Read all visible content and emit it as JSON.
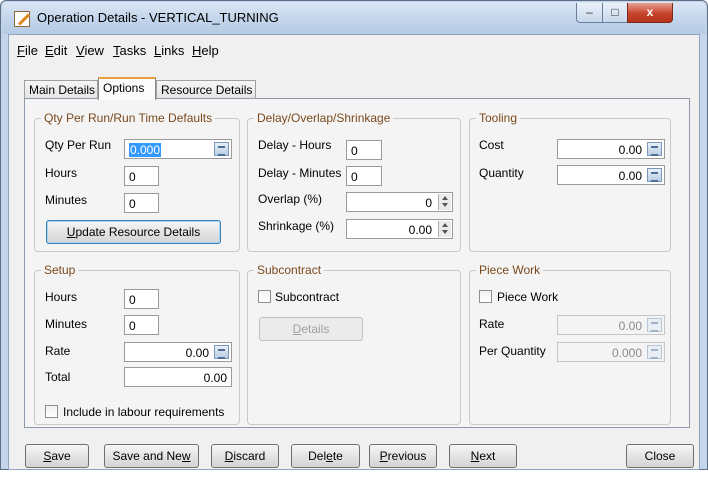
{
  "window": {
    "title": "Operation Details - VERTICAL_TURNING",
    "minimize_glyph": "–",
    "maximize_glyph": "□",
    "close_glyph": "x"
  },
  "menu": [
    {
      "label": "File",
      "access": "F",
      "rest": "ile"
    },
    {
      "label": "Edit",
      "access": "E",
      "rest": "dit"
    },
    {
      "label": "View",
      "access": "V",
      "rest": "iew"
    },
    {
      "label": "Tasks",
      "access": "T",
      "rest": "asks"
    },
    {
      "label": "Links",
      "access": "L",
      "rest": "inks"
    },
    {
      "label": "Help",
      "access": "H",
      "rest": "elp"
    }
  ],
  "tabs": [
    {
      "label": "Main Details",
      "active": false
    },
    {
      "label": "Options",
      "active": true
    },
    {
      "label": "Resource Details",
      "active": false
    }
  ],
  "qty_group": {
    "title": "Qty Per Run/Run Time Defaults",
    "qty_per_run_label": "Qty Per Run",
    "qty_per_run_value": "0.000",
    "hours_label": "Hours",
    "hours_value": "0",
    "minutes_label": "Minutes",
    "minutes_value": "0",
    "update_button": {
      "access": "U",
      "rest": "pdate Resource Details"
    }
  },
  "delay_group": {
    "title": "Delay/Overlap/Shrinkage",
    "delay_hours_label": "Delay - Hours",
    "delay_hours_value": "0",
    "delay_minutes_label": "Delay - Minutes",
    "delay_minutes_value": "0",
    "overlap_label": "Overlap (%)",
    "overlap_value": "0",
    "shrinkage_label": "Shrinkage (%)",
    "shrinkage_value": "0.00"
  },
  "tooling_group": {
    "title": "Tooling",
    "cost_label": "Cost",
    "cost_value": "0.00",
    "quantity_label": "Quantity",
    "quantity_value": "0.00"
  },
  "setup_group": {
    "title": "Setup",
    "hours_label": "Hours",
    "hours_value": "0",
    "minutes_label": "Minutes",
    "minutes_value": "0",
    "rate_label": "Rate",
    "rate_value": "0.00",
    "total_label": "Total",
    "total_value": "0.00",
    "include_label": "Include in labour requirements",
    "include_checked": false
  },
  "subcontract_group": {
    "title": "Subcontract",
    "checkbox_label": "Subcontract",
    "checked": false,
    "details_button": {
      "access": "D",
      "rest": "etails"
    }
  },
  "piecework_group": {
    "title": "Piece Work",
    "checkbox_label": "Piece Work",
    "checked": false,
    "rate_label": "Rate",
    "rate_value": "0.00",
    "per_quantity_label": "Per Quantity",
    "per_quantity_value": "0.000"
  },
  "footer_buttons": {
    "save": {
      "access": "S",
      "rest": "ave"
    },
    "save_new": {
      "pre": "Save and Ne",
      "access": "w",
      "rest": ""
    },
    "discard": {
      "access": "D",
      "rest": "iscard"
    },
    "delete": {
      "pre": "Del",
      "access": "e",
      "rest": "te"
    },
    "previous": {
      "access": "P",
      "rest": "revious"
    },
    "next": {
      "access": "N",
      "rest": "ext"
    },
    "close": "Close"
  },
  "colors": {
    "group_title": "#7a4a1e",
    "active_tab_accent": "#e9a23b",
    "selection": "#3399ff",
    "close_button": "#c7442c"
  }
}
